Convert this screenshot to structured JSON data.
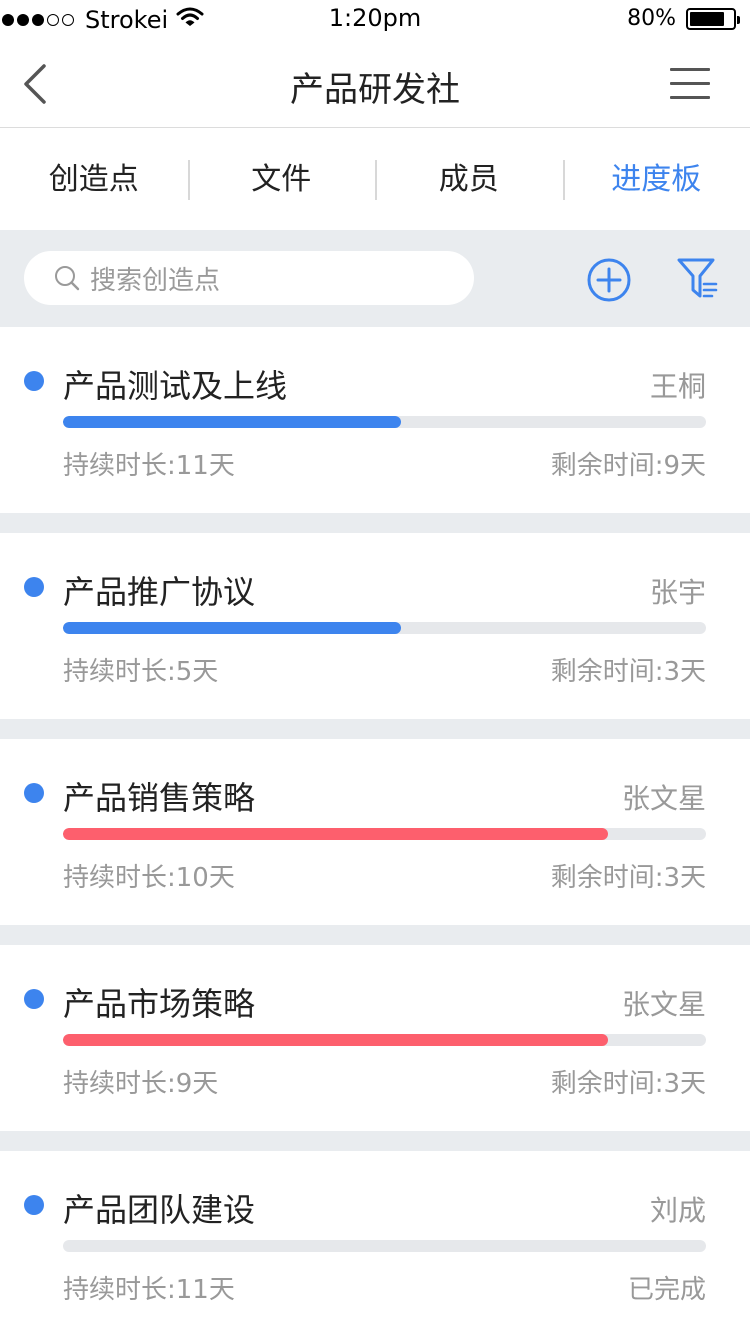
{
  "status_bar": {
    "carrier": "Strokei",
    "time": "1:20pm",
    "battery": "80%",
    "battery_level": 0.8
  },
  "nav": {
    "title": "产品研发社",
    "back_icon": "chevron-left-icon",
    "menu_icon": "hamburger-menu-icon"
  },
  "tabs": [
    {
      "label": "创造点",
      "active": false
    },
    {
      "label": "文件",
      "active": false
    },
    {
      "label": "成员",
      "active": false
    },
    {
      "label": "进度板",
      "active": true
    }
  ],
  "search": {
    "placeholder": "搜索创造点",
    "icon": "search-icon"
  },
  "actions": {
    "add_icon": "plus-circle-icon",
    "filter_icon": "filter-icon"
  },
  "colors": {
    "accent": "#3d84ee",
    "progress_blue": "#3d84ee",
    "progress_red": "#fd5f6d",
    "track": "#e6e8eb"
  },
  "tasks": [
    {
      "title": "产品测试及上线",
      "owner": "王桐",
      "progress": 0.525,
      "progress_color": "#3d84ee",
      "duration": "持续时长:11天",
      "remaining": "剩余时间:9天"
    },
    {
      "title": "产品推广协议",
      "owner": "张宇",
      "progress": 0.525,
      "progress_color": "#3d84ee",
      "duration": "持续时长:5天",
      "remaining": "剩余时间:3天"
    },
    {
      "title": "产品销售策略",
      "owner": "张文星",
      "progress": 0.848,
      "progress_color": "#fd5f6d",
      "duration": "持续时长:10天",
      "remaining": "剩余时间:3天"
    },
    {
      "title": "产品市场策略",
      "owner": "张文星",
      "progress": 0.848,
      "progress_color": "#fd5f6d",
      "duration": "持续时长:9天",
      "remaining": "剩余时间:3天"
    },
    {
      "title": "产品团队建设",
      "owner": "刘成",
      "progress": 0,
      "progress_color": "#3d84ee",
      "duration": "持续时长:11天",
      "remaining": "已完成"
    }
  ]
}
